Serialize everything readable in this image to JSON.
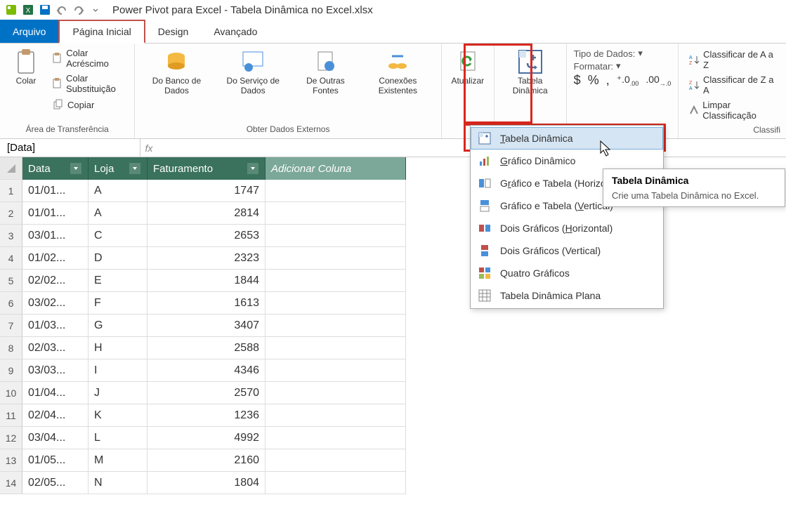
{
  "window": {
    "title": "Power Pivot para Excel - Tabela Dinâmica no Excel.xlsx"
  },
  "tabs": {
    "file": "Arquivo",
    "home": "Página Inicial",
    "design": "Design",
    "advanced": "Avançado"
  },
  "ribbon": {
    "clipboard": {
      "paste": "Colar",
      "paste_append": "Colar Acréscimo",
      "paste_replace": "Colar Substituição",
      "copy": "Copiar",
      "group_label": "Área de Transferência"
    },
    "external_data": {
      "from_db": "Do Banco\nde Dados",
      "from_service": "Do Serviço\nde Dados",
      "from_other": "De Outras\nFontes",
      "existing_conn": "Conexões\nExistentes",
      "group_label": "Obter Dados Externos"
    },
    "refresh": "Atualizar",
    "pivot": "Tabela\nDinâmica",
    "formatting": {
      "data_type": "Tipo de Dados:",
      "format": "Formatar:",
      "currency": "$",
      "percent": "%",
      "comma": ",",
      "inc_dec": "⁺.0",
      "dec_dec": ".00"
    },
    "sort": {
      "az": "Classificar de A a Z",
      "za": "Classificar de Z a A",
      "clear": "Limpar Classificação",
      "group_label": "Classifi"
    }
  },
  "formula_bar": {
    "name": "[Data]",
    "fx": "fx"
  },
  "table": {
    "columns": [
      "Data",
      "Loja",
      "Faturamento"
    ],
    "add_column": "Adicionar Coluna",
    "rows": [
      {
        "n": 1,
        "data": "01/01...",
        "loja": "A",
        "fat": 1747
      },
      {
        "n": 2,
        "data": "01/01...",
        "loja": "A",
        "fat": 2814
      },
      {
        "n": 3,
        "data": "03/01...",
        "loja": "C",
        "fat": 2653
      },
      {
        "n": 4,
        "data": "01/02...",
        "loja": "D",
        "fat": 2323
      },
      {
        "n": 5,
        "data": "02/02...",
        "loja": "E",
        "fat": 1844
      },
      {
        "n": 6,
        "data": "03/02...",
        "loja": "F",
        "fat": 1613
      },
      {
        "n": 7,
        "data": "01/03...",
        "loja": "G",
        "fat": 3407
      },
      {
        "n": 8,
        "data": "02/03...",
        "loja": "H",
        "fat": 2588
      },
      {
        "n": 9,
        "data": "03/03...",
        "loja": "I",
        "fat": 4346
      },
      {
        "n": 10,
        "data": "01/04...",
        "loja": "J",
        "fat": 2570
      },
      {
        "n": 11,
        "data": "02/04...",
        "loja": "K",
        "fat": 1236
      },
      {
        "n": 12,
        "data": "03/04...",
        "loja": "L",
        "fat": 4992
      },
      {
        "n": 13,
        "data": "01/05...",
        "loja": "M",
        "fat": 2160
      },
      {
        "n": 14,
        "data": "02/05...",
        "loja": "N",
        "fat": 1804
      }
    ]
  },
  "dropdown": {
    "items": [
      {
        "icon": "pivot-table",
        "label": "Tabela Dinâmica",
        "ul": "T"
      },
      {
        "icon": "pivot-chart",
        "label": "Gráfico Dinâmico",
        "ul": "G"
      },
      {
        "icon": "chart-table-h",
        "label": "Gráfico e Tabela (Horizontal)",
        "ul": "riz"
      },
      {
        "icon": "chart-table-v",
        "label": "Gráfico e Tabela (Vertical)",
        "ul": "V"
      },
      {
        "icon": "two-charts-h",
        "label": "Dois Gráficos (Horizontal)",
        "ul": "H"
      },
      {
        "icon": "two-charts-v",
        "label": "Dois Gráficos (Vertical)",
        "ul": ""
      },
      {
        "icon": "four-charts",
        "label": "Quatro Gráficos",
        "ul": ""
      },
      {
        "icon": "flat-pivot",
        "label": "Tabela Dinâmica Plana",
        "ul": ""
      }
    ]
  },
  "tooltip": {
    "title": "Tabela Dinâmica",
    "body": "Crie uma Tabela Dinâmica no Excel."
  }
}
